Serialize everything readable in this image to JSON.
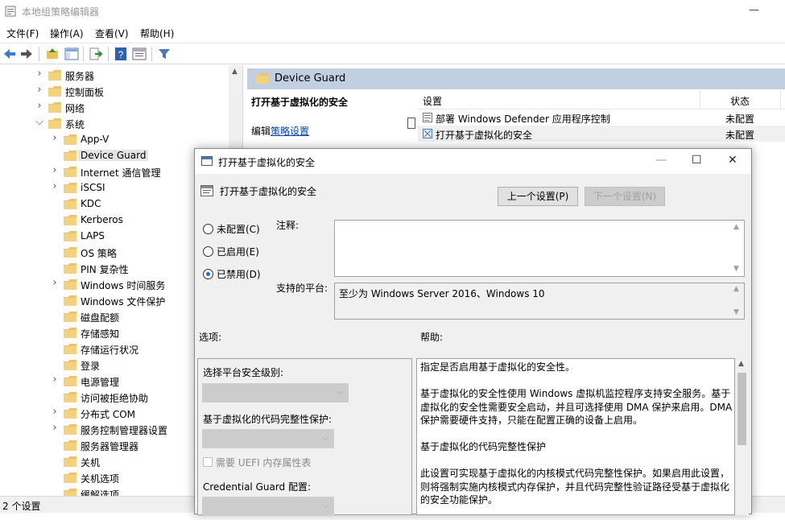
{
  "window": {
    "title": "本地组策略编辑器"
  },
  "menu": [
    "文件(F)",
    "操作(A)",
    "查看(V)",
    "帮助(H)"
  ],
  "tree": {
    "items": [
      {
        "label": "服务器",
        "level": 2,
        "expander": ">"
      },
      {
        "label": "控制面板",
        "level": 2,
        "expander": ">"
      },
      {
        "label": "网络",
        "level": 2,
        "expander": ">"
      },
      {
        "label": "系统",
        "level": 2,
        "expander": "v"
      },
      {
        "label": "App-V",
        "level": 3,
        "expander": ">"
      },
      {
        "label": "Device Guard",
        "level": 3,
        "expander": "",
        "selected": true
      },
      {
        "label": "Internet 通信管理",
        "level": 3,
        "expander": ">"
      },
      {
        "label": "iSCSI",
        "level": 3,
        "expander": ">"
      },
      {
        "label": "KDC",
        "level": 3,
        "expander": ""
      },
      {
        "label": "Kerberos",
        "level": 3,
        "expander": ""
      },
      {
        "label": "LAPS",
        "level": 3,
        "expander": ""
      },
      {
        "label": "OS 策略",
        "level": 3,
        "expander": ""
      },
      {
        "label": "PIN 复杂性",
        "level": 3,
        "expander": ""
      },
      {
        "label": "Windows 时间服务",
        "level": 3,
        "expander": ">"
      },
      {
        "label": "Windows 文件保护",
        "level": 3,
        "expander": ""
      },
      {
        "label": "磁盘配额",
        "level": 3,
        "expander": ""
      },
      {
        "label": "存储感知",
        "level": 3,
        "expander": ""
      },
      {
        "label": "存储运行状况",
        "level": 3,
        "expander": ""
      },
      {
        "label": "登录",
        "level": 3,
        "expander": ""
      },
      {
        "label": "电源管理",
        "level": 3,
        "expander": ">"
      },
      {
        "label": "访问被拒绝协助",
        "level": 3,
        "expander": ""
      },
      {
        "label": "分布式 COM",
        "level": 3,
        "expander": ">"
      },
      {
        "label": "服务控制管理器设置",
        "level": 3,
        "expander": ">"
      },
      {
        "label": "服务器管理器",
        "level": 3,
        "expander": ""
      },
      {
        "label": "关机",
        "level": 3,
        "expander": ""
      },
      {
        "label": "关机选项",
        "level": 3,
        "expander": ""
      },
      {
        "label": "缓解选项",
        "level": 3,
        "expander": ""
      }
    ]
  },
  "right": {
    "header": "Device Guard",
    "desc_title": "打开基于虚拟化的安全",
    "desc_edit_prefix": "编辑",
    "desc_edit_link": "策略设置",
    "col_setting": "设置",
    "col_state": "状态",
    "rows": [
      {
        "name": "部署 Windows Defender 应用程序控制",
        "state": "未配置"
      },
      {
        "name": "打开基于虚拟化的安全",
        "state": "未配置"
      }
    ]
  },
  "status": "2 个设置",
  "dialog": {
    "title": "打开基于虚拟化的安全",
    "setting_name": "打开基于虚拟化的安全",
    "prev_button": "上一个设置(P)",
    "next_button": "下一个设置(N)",
    "radios": [
      {
        "label": "未配置(C)",
        "checked": false
      },
      {
        "label": "已启用(E)",
        "checked": false
      },
      {
        "label": "已禁用(D)",
        "checked": true
      }
    ],
    "comment_label": "注释:",
    "comment_value": "",
    "platform_label": "支持的平台:",
    "platform_value": "至少为 Windows Server 2016、Windows 10",
    "options_label": "选项:",
    "help_label": "帮助:",
    "options": {
      "platform_level_label": "选择平台安全级别:",
      "code_integrity_label": "基于虚拟化的代码完整性保护:",
      "uefi_checkbox_label": "需要 UEFI 内存属性表",
      "credential_guard_label": "Credential Guard 配置:"
    },
    "help": [
      "指定是否启用基于虚拟化的安全性。",
      "基于虚拟化的安全性使用 Windows 虚拟机监控程序支持安全服务。基于虚拟化的安全性需要安全启动，并且可选择使用 DMA 保护来启用。DMA 保护需要硬件支持，只能在配置正确的设备上启用。",
      "基于虚拟化的代码完整性保护",
      "此设置可实现基于虚拟化的内核模式代码完整性保护。如果启用此设置，则将强制实施内核模式内存保护，并且代码完整性验证路径受基于虚拟化的安全功能保护。"
    ]
  }
}
